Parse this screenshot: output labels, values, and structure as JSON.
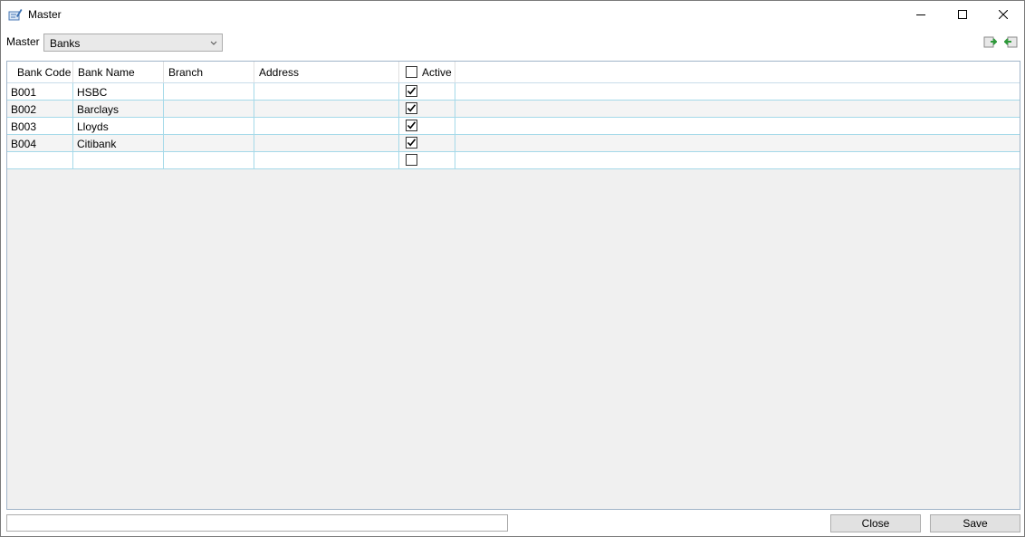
{
  "window": {
    "title": "Master"
  },
  "toolbar": {
    "master_label": "Master",
    "master_selected": "Banks"
  },
  "grid": {
    "columns": [
      "Bank Code",
      "Bank Name",
      "Branch",
      "Address",
      "Active"
    ],
    "header_active_checked": false,
    "rows": [
      {
        "code": "B001",
        "name": "HSBC",
        "branch": "",
        "address": "",
        "active": true
      },
      {
        "code": "B002",
        "name": "Barclays",
        "branch": "",
        "address": "",
        "active": true
      },
      {
        "code": "B003",
        "name": "Lloyds",
        "branch": "",
        "address": "",
        "active": true
      },
      {
        "code": "B004",
        "name": "Citibank",
        "branch": "",
        "address": "",
        "active": true
      }
    ],
    "new_row": {
      "active": false
    }
  },
  "footer": {
    "status_value": "",
    "close_label": "Close",
    "save_label": "Save"
  },
  "icons": {
    "app": "app-edit-icon",
    "import": "import-icon",
    "export": "export-icon"
  }
}
